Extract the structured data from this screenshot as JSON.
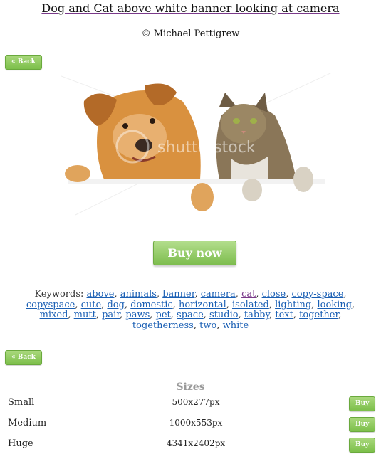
{
  "header": {
    "title": "Dog and Cat above white banner looking at camera",
    "credit": "© Michael Pettigrew"
  },
  "nav": {
    "back_label": "« Back"
  },
  "image": {
    "watermark": "shutterstock"
  },
  "purchase": {
    "buy_now_label": "Buy now"
  },
  "keywords": {
    "label": "Keywords:",
    "items": [
      "above",
      "animals",
      "banner",
      "camera",
      "cat",
      "close",
      "copy-space",
      "copyspace",
      "cute",
      "dog",
      "domestic",
      "horizontal",
      "isolated",
      "lighting",
      "looking",
      "mixed",
      "mutt",
      "pair",
      "paws",
      "pet",
      "space",
      "studio",
      "tabby",
      "text",
      "together",
      "togetherness",
      "two",
      "white"
    ]
  },
  "sizes": {
    "title": "Sizes",
    "buy_label": "Buy",
    "rows": [
      {
        "name": "Small",
        "dims": "500x277px"
      },
      {
        "name": "Medium",
        "dims": "1000x553px"
      },
      {
        "name": "Huge",
        "dims": "4341x2402px"
      }
    ]
  },
  "colors": {
    "button_green": "#7cbf4a",
    "link_blue": "#1a5fb4",
    "link_visited": "#7a3a8a"
  }
}
